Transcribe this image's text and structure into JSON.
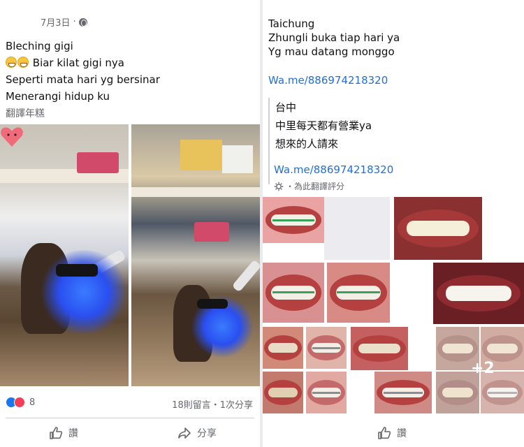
{
  "left_post": {
    "date": "7月3日",
    "dot": "·",
    "lines": [
      "Bleching gigi",
      "Biar kilat gigi nya",
      "Seperti mata hari yg bersinar",
      "Menerangi hidup ku"
    ],
    "translate_label": "翻譯年糕",
    "reaction_count": "8",
    "comments_shares": "18則留言・1次分享",
    "like_label": "讚",
    "share_label": "分享"
  },
  "right_post": {
    "lines": [
      "Taichung",
      "Zhungli buka tiap hari ya",
      "Yg mau datang monggo"
    ],
    "wa_link": "Wa.me/886974218320",
    "translated_lines": [
      "台中",
      "中里每天都有營業ya",
      "想來的人請來"
    ],
    "translated_wa_link": "Wa.me/886974218320",
    "rate_label": "・為此翻譯評分",
    "more_photos": "+2",
    "like_label": "讚"
  },
  "icons": {
    "globe": "globe-icon",
    "like": "thumbs-up-icon",
    "share": "share-arrow-icon",
    "gear": "gear-icon",
    "heart": "heart-sticker-icon"
  },
  "colors": {
    "link": "#216fdb",
    "like_reaction": "#1877f2",
    "love_reaction": "#f33e58",
    "meta_text": "#65676b"
  }
}
